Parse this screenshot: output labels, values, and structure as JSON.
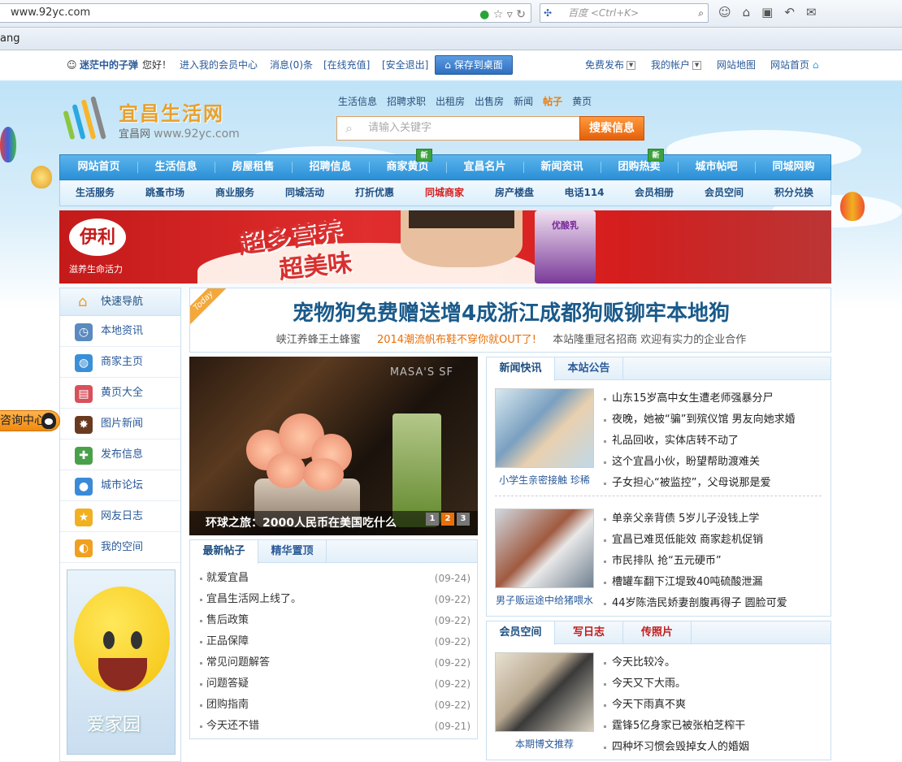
{
  "browser": {
    "url": "www.92yc.com",
    "search_placeholder": "百度 <Ctrl+K>",
    "bookmark_text": "ang"
  },
  "member_bar": {
    "username": "迷茫中的子弹",
    "greeting": "您好！",
    "member_center": "进入我的会员中心",
    "messages": "消息(0)条",
    "recharge": "[在线充值]",
    "logout": "[安全退出]",
    "save_desktop": "保存到桌面",
    "free_post": "免费发布",
    "my_account": "我的帐户",
    "site_map": "网站地图",
    "home": "网站首页"
  },
  "logo": {
    "title": "宜昌生活网",
    "subtitle": "宜昌网",
    "domain": "www.92yc.com"
  },
  "search": {
    "tabs": [
      "生活信息",
      "招聘求职",
      "出租房",
      "出售房",
      "新闻",
      "帖子",
      "黄页"
    ],
    "active_tab": "帖子",
    "placeholder": "请输入关键字",
    "button": "搜索信息"
  },
  "main_nav": [
    "网站首页",
    "生活信息",
    "房屋租售",
    "招聘信息",
    "商家黄页",
    "宜昌名片",
    "新闻资讯",
    "团购热卖",
    "城市帖吧",
    "同城网购"
  ],
  "new_badge": "新",
  "sub_nav": [
    "生活服务",
    "跳蚤市场",
    "商业服务",
    "同城活动",
    "打折优惠",
    "同城商家",
    "房产楼盘",
    "电话114",
    "会员相册",
    "会员空间",
    "积分兑换"
  ],
  "banner": {
    "brand": "伊利",
    "tagline": "滋养生命活力",
    "slogan_line1": "超多营养",
    "slogan_line2": "超美味",
    "bottle_label": "优酸乳"
  },
  "sidebar": {
    "head": "快速导航",
    "items": [
      "本地资讯",
      "商家主页",
      "黄页大全",
      "图片新闻",
      "发布信息",
      "城市论坛",
      "网友日志",
      "我的空间"
    ],
    "card_text": "爱家园",
    "consult": "咨询中心"
  },
  "headline": {
    "ribbon": "Today",
    "title": "宠物狗免费赠送增4成浙江成都狗贩铆牢本地狗",
    "links": [
      "峡江养蜂王土蜂蜜",
      "2014潮流帆布鞋不穿你就OUT了!",
      "本站隆重冠名招商 欢迎有实力的企业合作"
    ]
  },
  "slider": {
    "watermark": "MASA'S SF",
    "caption": "环球之旅：2000人民币在美国吃什么",
    "pages": [
      "1",
      "2",
      "3"
    ],
    "active_page": 1
  },
  "posts_box": {
    "tabs": [
      "最新帖子",
      "精华置顶"
    ],
    "items": [
      {
        "title": "就爱宜昌",
        "date": "(09-24)"
      },
      {
        "title": "宜昌生活网上线了。",
        "date": "(09-22)"
      },
      {
        "title": "售后政策",
        "date": "(09-22)"
      },
      {
        "title": "正品保障",
        "date": "(09-22)"
      },
      {
        "title": "常见问题解答",
        "date": "(09-22)"
      },
      {
        "title": "问题答疑",
        "date": "(09-22)"
      },
      {
        "title": "团购指南",
        "date": "(09-22)"
      },
      {
        "title": "今天还不错",
        "date": "(09-21)"
      }
    ]
  },
  "news_box": {
    "tabs": [
      "新闻快讯",
      "本站公告"
    ],
    "group1": {
      "caption": "小学生亲密接触 珍稀",
      "items": [
        "山东15岁高中女生遭老师强暴分尸",
        "夜晚，她被“骗”到殡仪馆 男友向她求婚",
        "礼品回收，实体店转不动了",
        "这个宜昌小伙，盼望帮助渡难关",
        "子女担心“被监控”，父母说那是爱"
      ]
    },
    "group2": {
      "caption": "男子贩运途中给猪喂水",
      "items": [
        "单亲父亲背债 5岁儿子没钱上学",
        "宜昌已难觅低能效 商家趁机促销",
        "市民排队 抢“五元硬币”",
        "槽罐车翻下江堤致40吨硫酸泄漏",
        "44岁陈浩民娇妻剖腹再得子 圆脸可爱"
      ]
    }
  },
  "member_box": {
    "tabs": [
      "会员空间",
      "写日志",
      "传照片"
    ],
    "caption": "本期博文推荐",
    "items": [
      "今天比较冷。",
      "今天又下大雨。",
      "今天下雨真不爽",
      "霆锋5亿身家已被张柏芝榨干",
      "四种坏习惯会毁掉女人的婚姻"
    ]
  },
  "colors": {
    "nav_blue": "#2a8fd6",
    "accent_orange": "#e5600a",
    "banner_red": "#c41a1a",
    "link_blue": "#2a5a9a"
  }
}
